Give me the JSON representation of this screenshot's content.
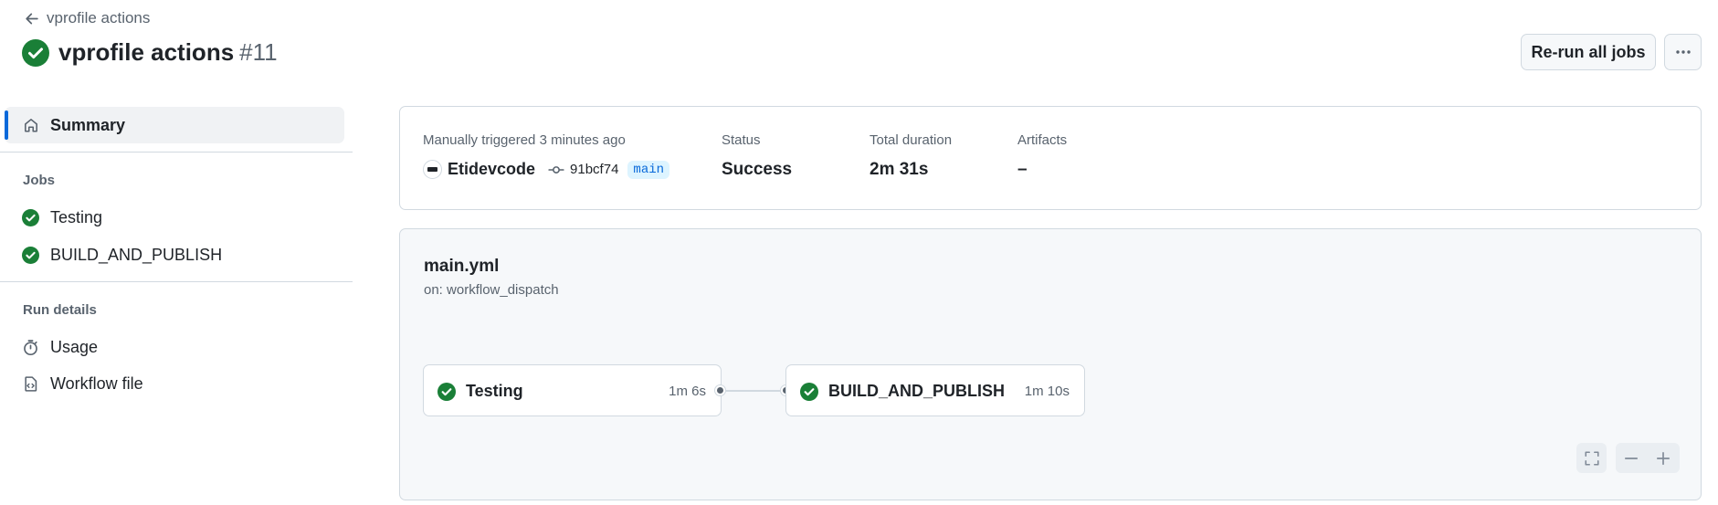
{
  "header": {
    "back_label": "vprofile actions",
    "title": "vprofile actions",
    "run_number": "#11",
    "rerun_label": "Re-run all jobs"
  },
  "sidebar": {
    "summary_label": "Summary",
    "jobs_section": "Jobs",
    "jobs": [
      {
        "label": "Testing",
        "status": "success"
      },
      {
        "label": "BUILD_AND_PUBLISH",
        "status": "success"
      }
    ],
    "run_details_section": "Run details",
    "details": [
      {
        "label": "Usage",
        "icon": "stopwatch-icon"
      },
      {
        "label": "Workflow file",
        "icon": "file-code-icon"
      }
    ]
  },
  "summary": {
    "trigger_label": "Manually triggered 3 minutes ago",
    "actor": "Etidevcode",
    "commit_sha": "91bcf74",
    "branch": "main",
    "status_label": "Status",
    "status_value": "Success",
    "duration_label": "Total duration",
    "duration_value": "2m 31s",
    "artifacts_label": "Artifacts",
    "artifacts_value": "–"
  },
  "workflow": {
    "file_name": "main.yml",
    "trigger": "on: workflow_dispatch",
    "jobs": [
      {
        "name": "Testing",
        "duration": "1m 6s",
        "status": "success"
      },
      {
        "name": "BUILD_AND_PUBLISH",
        "duration": "1m 10s",
        "status": "success"
      }
    ]
  },
  "colors": {
    "success": "#1a7f37",
    "accent": "#0969da",
    "border": "#d1d9e0",
    "muted": "#59636e"
  }
}
